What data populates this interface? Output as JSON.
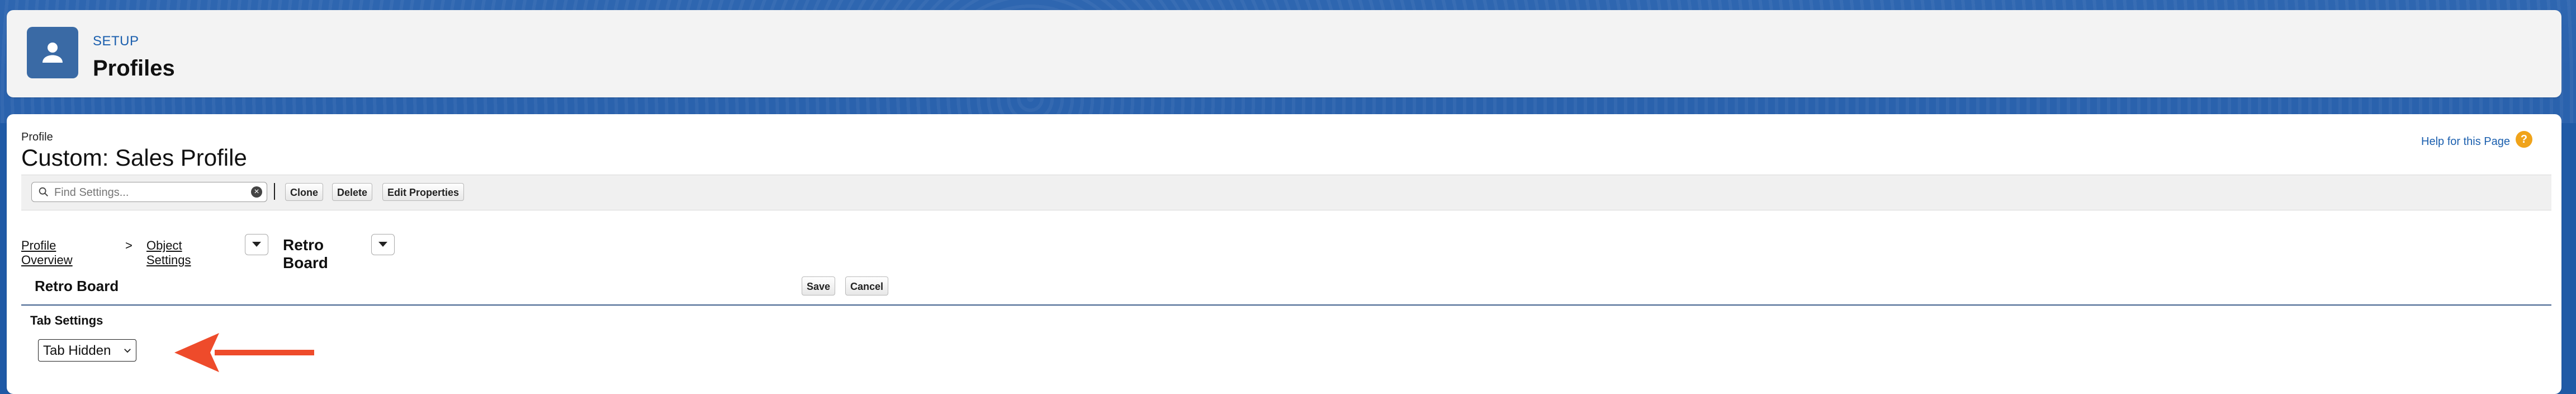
{
  "header": {
    "eyebrow": "SETUP",
    "title": "Profiles",
    "icon": "user-icon"
  },
  "profile": {
    "label": "Profile",
    "title": "Custom: Sales Profile"
  },
  "help": {
    "link_text": "Help for this Page",
    "icon": "help-icon",
    "icon_glyph": "?"
  },
  "toolbar": {
    "search_placeholder": "Find Settings...",
    "buttons": {
      "clone": "Clone",
      "delete": "Delete",
      "edit_properties": "Edit Properties"
    }
  },
  "breadcrumb": {
    "overview": "Profile Overview",
    "separator": ">",
    "object_settings": "Object Settings",
    "current": "Retro Board"
  },
  "section": {
    "title": "Retro Board",
    "save": "Save",
    "cancel": "Cancel"
  },
  "tab_settings": {
    "label": "Tab Settings",
    "selected_value": "Tab Hidden"
  },
  "colors": {
    "background": "#1f5aa6",
    "card": "#ffffff",
    "header_bg": "#f3f3f3",
    "link": "#1b5fae",
    "arrow": "#ee4b2b",
    "help_icon": "#f0a31a"
  }
}
